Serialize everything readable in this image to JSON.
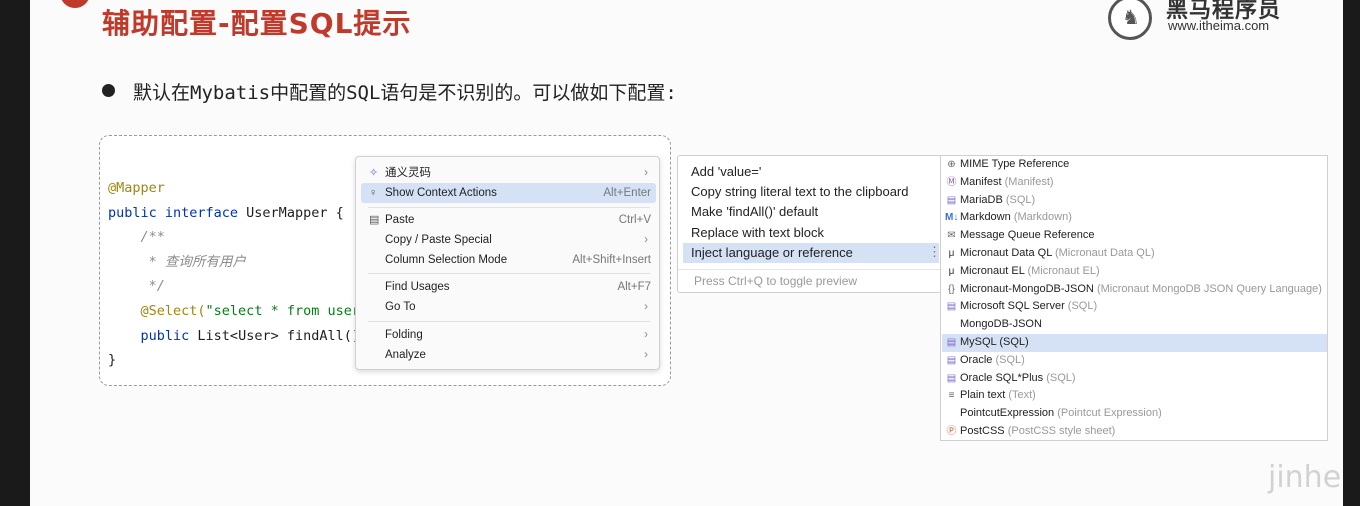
{
  "slide": {
    "title": "辅助配置-配置SQL提示",
    "logo_cn": "黑马程序员",
    "logo_url": "www.itheima.com",
    "bullet": "默认在Mybatis中配置的SQL语句是不识别的。可以做如下配置:",
    "watermark": "jinhei.cn"
  },
  "code": {
    "line1": "@Mapper",
    "line2_kw": "public interface",
    "line2_rest": " UserMapper {",
    "line3": "/**",
    "line4": "* 查询所有用户",
    "line5": "*/",
    "line6_ann": "@Select(",
    "line6_str": "\"select * from user",
    "line7_kw": "public",
    "line7_rest": " List<User> findAll()",
    "line8": "}"
  },
  "context_menu": {
    "items": [
      {
        "label": "通义灵码",
        "icon": "tongyi-icon",
        "shortcut": "",
        "submenu": true
      },
      {
        "label": "Show Context Actions",
        "icon": "bulb-icon",
        "shortcut": "Alt+Enter",
        "selected": true
      },
      {
        "label": "Paste",
        "icon": "paste-icon",
        "shortcut": "Ctrl+V"
      },
      {
        "label": "Copy / Paste Special",
        "shortcut": "",
        "submenu": true
      },
      {
        "label": "Column Selection Mode",
        "shortcut": "Alt+Shift+Insert"
      },
      {
        "label": "Find Usages",
        "shortcut": "Alt+F7"
      },
      {
        "label": "Go To",
        "shortcut": "",
        "submenu": true
      },
      {
        "label": "Folding",
        "shortcut": "",
        "submenu": true
      },
      {
        "label": "Analyze",
        "shortcut": "",
        "submenu": true
      }
    ]
  },
  "intentions": {
    "items": [
      "Add 'value='",
      "Copy string literal text to the clipboard",
      "Make 'findAll()' default",
      "Replace with text block",
      "Inject language or reference"
    ],
    "hint": "Press Ctrl+Q to toggle preview"
  },
  "languages": {
    "items": [
      {
        "name": "MIME Type Reference",
        "sub": "",
        "icon": "globe-icon"
      },
      {
        "name": "Manifest",
        "sub": "(Manifest)",
        "icon": "manifest-icon"
      },
      {
        "name": "MariaDB",
        "sub": "(SQL)",
        "icon": "database-icon"
      },
      {
        "name": "Markdown",
        "sub": "(Markdown)",
        "icon": "markdown-icon"
      },
      {
        "name": "Message Queue Reference",
        "sub": "",
        "icon": "queue-icon"
      },
      {
        "name": "Micronaut Data QL",
        "sub": "(Micronaut Data QL)",
        "icon": "micronaut-icon"
      },
      {
        "name": "Micronaut EL",
        "sub": "(Micronaut EL)",
        "icon": "micronaut-icon"
      },
      {
        "name": "Micronaut-MongoDB-JSON",
        "sub": "(Micronaut MongoDB JSON Query Language)",
        "icon": "braces-icon"
      },
      {
        "name": "Microsoft SQL Server",
        "sub": "(SQL)",
        "icon": "database-icon"
      },
      {
        "name": "MongoDB-JSON",
        "sub": "",
        "icon": ""
      },
      {
        "name": "MySQL (SQL)",
        "sub": "",
        "icon": "database-icon",
        "selected": true
      },
      {
        "name": "Oracle",
        "sub": "(SQL)",
        "icon": "database-icon"
      },
      {
        "name": "Oracle SQL*Plus",
        "sub": "(SQL)",
        "icon": "database-icon"
      },
      {
        "name": "Plain text",
        "sub": "(Text)",
        "icon": "text-icon"
      },
      {
        "name": "PointcutExpression",
        "sub": "(Pointcut Expression)",
        "icon": ""
      },
      {
        "name": "PostCSS",
        "sub": "(PostCSS style sheet)",
        "icon": "postcss-icon"
      }
    ]
  },
  "colors": {
    "title_red": "#c0392b",
    "selection": "#d5e1f5",
    "keyword": "#0033b3",
    "annotation": "#9e880d",
    "string": "#067d17"
  }
}
